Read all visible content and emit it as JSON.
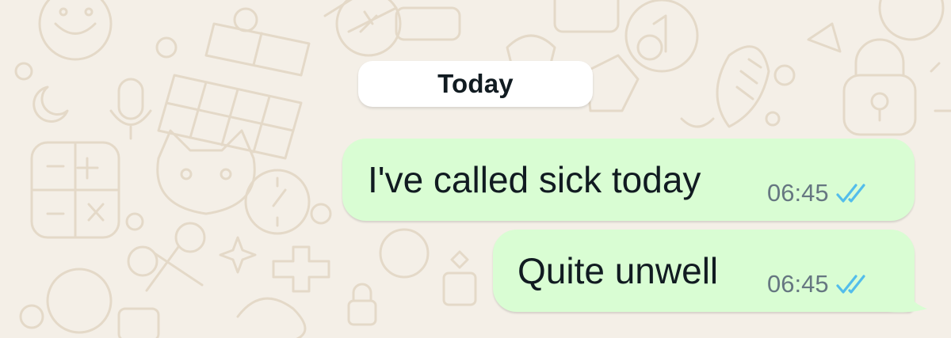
{
  "chat": {
    "date_separator": "Today",
    "messages": [
      {
        "text": "I've called sick today",
        "time": "06:45",
        "status_icon": "double-check-read-icon",
        "direction": "outgoing"
      },
      {
        "text": "Quite unwell",
        "time": "06:45",
        "status_icon": "double-check-read-icon",
        "direction": "outgoing"
      }
    ]
  },
  "colors": {
    "wallpaper": "#f4efe7",
    "wallpaper_doodle": "#e4d9c8",
    "outgoing_bubble": "#d9fdd3",
    "date_pill": "#ffffff",
    "text": "#111b21",
    "timestamp": "#667781",
    "read_ticks": "#53bdeb"
  }
}
